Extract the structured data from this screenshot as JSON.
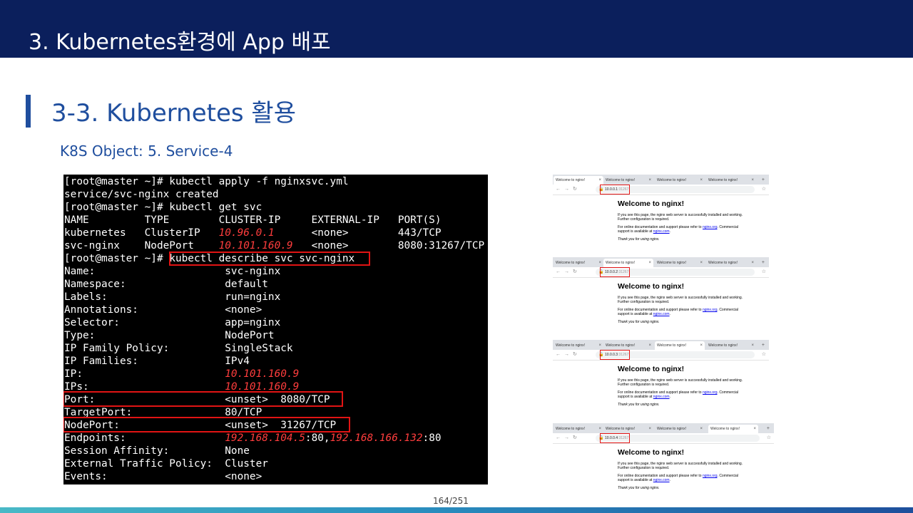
{
  "header": {
    "title": "3.  Kubernetes환경에 App 배포"
  },
  "section": {
    "title": "3-3. Kubernetes 활용",
    "subtitle": "K8S Object: 5. Service-4"
  },
  "terminal": {
    "line0": "[root@master ~]# kubectl apply -f nginxsvc.yml",
    "line1": "service/svc-nginx created",
    "line2": "[root@master ~]# kubectl get svc",
    "line3": "NAME         TYPE        CLUSTER-IP     EXTERNAL-IP   PORT(S)",
    "line4_pre": "kubernetes   ClusterIP   ",
    "line4_ip": "10.96.0.1",
    "line4_post": "      <none>        443/TCP",
    "line5_pre": "svc-nginx    NodePort    ",
    "line5_ip": "10.101.160.9",
    "line5_post": "   <none>        8080:31267/TCP",
    "line6_prompt": "[root@master ~]# ",
    "line6_cmd": "kubectl describe svc svc-nginx",
    "line7": "Name:                     svc-nginx",
    "line8": "Namespace:                default",
    "line9": "Labels:                   run=nginx",
    "line10": "Annotations:              <none>",
    "line11": "Selector:                 app=nginx",
    "line12": "Type:                     NodePort",
    "line13": "IP Family Policy:         SingleStack",
    "line14": "IP Families:              IPv4",
    "line15_pre": "IP:                       ",
    "line15_ip": "10.101.160.9",
    "line16_pre": "IPs:                      ",
    "line16_ip": "10.101.160.9",
    "line17": "Port:                     <unset>  8080/TCP",
    "line18": "TargetPort:               80/TCP",
    "line19": "NodePort:                 <unset>  31267/TCP",
    "line20_pre": "Endpoints:                ",
    "line20_ip1": "192.168.104.5",
    "line20_mid": ":80,",
    "line20_ip2": "192.168.166.132",
    "line20_post": ":80",
    "line21": "Session Affinity:         None",
    "line22": "External Traffic Policy:  Cluster",
    "line23": "Events:                   <none>"
  },
  "page_number": "164/251",
  "browsers": [
    {
      "tabs": [
        "Welcome to nginx!",
        "Welcome to nginx!",
        "Welcome to nginx!",
        "Welcome to nginx!"
      ],
      "url_host": "10.0.0.1",
      "url_port": ":31267",
      "title": "Welcome to nginx!",
      "p1": "If you see this page, the nginx web server is successfully installed and working. Further configuration is required.",
      "p2_a": "For online documentation and support please refer to ",
      "p2_link1": "nginx.org",
      "p2_b": ". Commercial support is available at ",
      "p2_link2": "nginx.com",
      "p2_c": ".",
      "p3": "Thank you for using nginx."
    },
    {
      "tabs": [
        "Welcome to nginx!",
        "Welcome to nginx!",
        "Welcome to nginx!",
        "Welcome to nginx!"
      ],
      "url_host": "10.0.0.2",
      "url_port": ":31267",
      "title": "Welcome to nginx!",
      "p1": "If you see this page, the nginx web server is successfully installed and working. Further configuration is required.",
      "p2_a": "For online documentation and support please refer to ",
      "p2_link1": "nginx.org",
      "p2_b": ". Commercial support is available at ",
      "p2_link2": "nginx.com",
      "p2_c": ".",
      "p3": "Thank you for using nginx."
    },
    {
      "tabs": [
        "Welcome to nginx!",
        "Welcome to nginx!",
        "Welcome to nginx!",
        "Welcome to nginx!"
      ],
      "url_host": "10.0.0.3",
      "url_port": ":31267",
      "title": "Welcome to nginx!",
      "p1": "If you see this page, the nginx web server is successfully installed and working. Further configuration is required.",
      "p2_a": "For online documentation and support please refer to ",
      "p2_link1": "nginx.org",
      "p2_b": ". Commercial support is available at ",
      "p2_link2": "nginx.com",
      "p2_c": ".",
      "p3": "Thank you for using nginx."
    },
    {
      "tabs": [
        "Welcome to nginx!",
        "Welcome to nginx!",
        "Welcome to nginx!",
        "Welcome to nginx!"
      ],
      "url_host": "10.0.0.4",
      "url_port": ":31267",
      "title": "Welcome to nginx!",
      "p1": "If you see this page, the nginx web server is successfully installed and working. Further configuration is required.",
      "p2_a": "For online documentation and support please refer to ",
      "p2_link1": "nginx.org",
      "p2_b": ". Commercial support is available at ",
      "p2_link2": "nginx.com",
      "p2_c": ".",
      "p3": "Thank you for using nginx."
    }
  ],
  "colors": {
    "header_bg": "#0b1f5c",
    "accent": "#1f4e9e",
    "highlight": "#e11414",
    "ip_text": "#ff3d3d"
  },
  "icons": [
    "back-arrow-icon",
    "forward-arrow-icon",
    "reload-icon",
    "lock-icon",
    "bookmark-star-icon",
    "tab-close-icon",
    "new-tab-icon"
  ]
}
